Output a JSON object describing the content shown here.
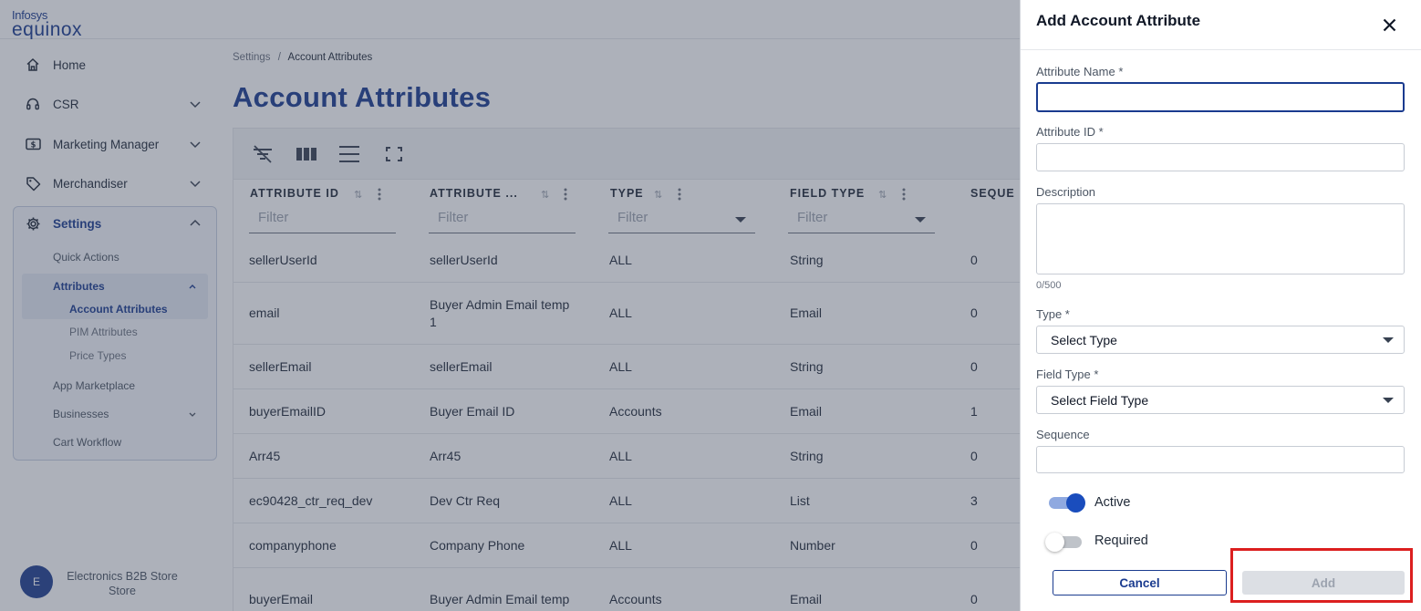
{
  "app": {
    "brand_top": "Infosys",
    "brand_bottom": "equinox"
  },
  "sidebar": {
    "items": [
      {
        "label": "Home",
        "icon": "home-icon"
      },
      {
        "label": "CSR",
        "icon": "headset-icon"
      },
      {
        "label": "Marketing Manager",
        "icon": "dollar-tag-icon"
      },
      {
        "label": "Merchandiser",
        "icon": "price-tag-icon"
      },
      {
        "label": "Settings",
        "icon": "gear-icon"
      }
    ],
    "settings_children": {
      "quick_actions": "Quick Actions",
      "attributes": "Attributes",
      "account_attributes": "Account Attributes",
      "pim_attributes": "PIM Attributes",
      "price_types": "Price Types",
      "app_marketplace": "App Marketplace",
      "businesses": "Businesses",
      "cart_workflow": "Cart Workflow"
    },
    "store": {
      "initial": "E",
      "name": "Electronics B2B Store Store"
    }
  },
  "breadcrumb": {
    "parent": "Settings",
    "separator": "/",
    "current": "Account Attributes"
  },
  "page_title": "Account Attributes",
  "grid": {
    "columns": [
      {
        "label": "ATTRIBUTE ID",
        "filter": "Filter"
      },
      {
        "label": "ATTRIBUTE ...",
        "filter": "Filter"
      },
      {
        "label": "TYPE",
        "filter": "Filter"
      },
      {
        "label": "FIELD TYPE",
        "filter": "Filter"
      },
      {
        "label": "SEQUE",
        "filter": ""
      }
    ],
    "rows": [
      [
        "sellerUserId",
        "sellerUserId",
        "ALL",
        "String",
        "0"
      ],
      [
        "email",
        "Buyer Admin Email temp 1",
        "ALL",
        "Email",
        "0"
      ],
      [
        "sellerEmail",
        "sellerEmail",
        "ALL",
        "String",
        "0"
      ],
      [
        "buyerEmailID",
        "Buyer Email ID",
        "Accounts",
        "Email",
        "1"
      ],
      [
        "Arr45",
        "Arr45",
        "ALL",
        "String",
        "0"
      ],
      [
        "ec90428_ctr_req_dev",
        "Dev Ctr Req",
        "ALL",
        "List",
        "3"
      ],
      [
        "companyphone",
        "Company Phone",
        "ALL",
        "Number",
        "0"
      ],
      [
        "buyerEmail",
        "Buyer Admin Email temp",
        "Accounts",
        "Email",
        "0"
      ]
    ]
  },
  "drawer": {
    "title": "Add Account Attribute",
    "attribute_name_label": "Attribute Name *",
    "attribute_name_value": "",
    "attribute_id_label": "Attribute ID *",
    "attribute_id_value": "",
    "description_label": "Description",
    "description_value": "",
    "description_counter": "0/500",
    "type_label": "Type *",
    "type_value": "Select Type",
    "field_type_label": "Field Type *",
    "field_type_value": "Select Field Type",
    "sequence_label": "Sequence",
    "sequence_value": "",
    "active_label": "Active",
    "active_on": true,
    "required_label": "Required",
    "required_on": false,
    "cancel_label": "Cancel",
    "add_label": "Add"
  },
  "colors": {
    "brand": "#1a3b8f",
    "highlight": "#dc1f1f",
    "toggle_on": "#1a4dbd"
  }
}
